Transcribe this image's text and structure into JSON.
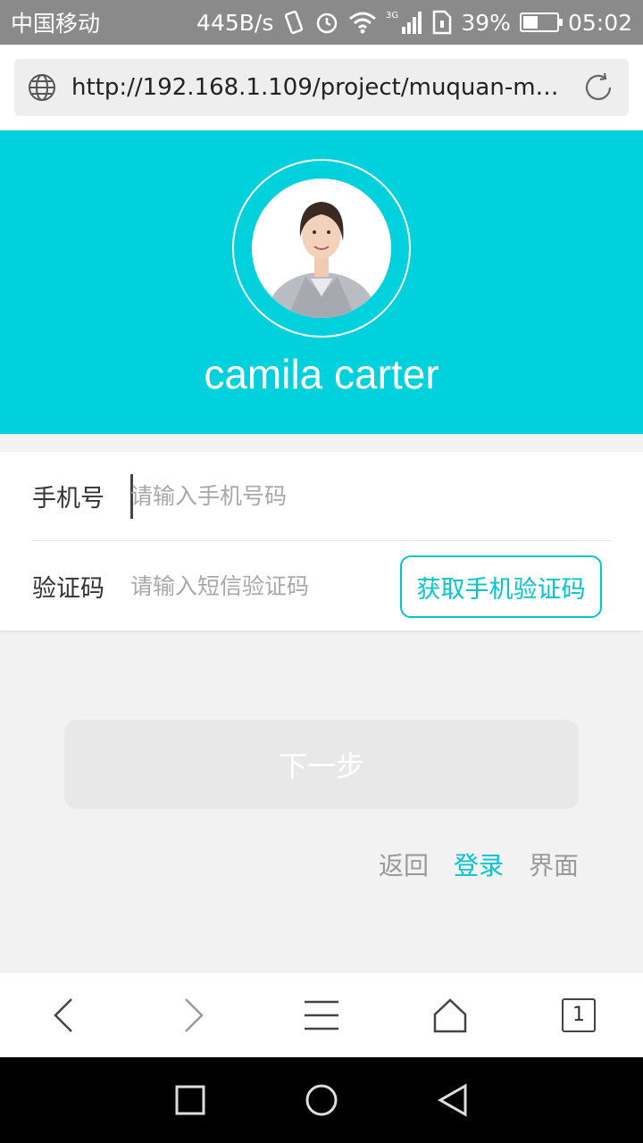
{
  "status_bar": {
    "carrier": "中国移动",
    "speed": "445B/s",
    "network": "3G",
    "battery": "39%",
    "battery_level": 0.39,
    "time": "05:02"
  },
  "browser": {
    "url": "http://192.168.1.109/project/muquan-mo…",
    "tab_count": "1"
  },
  "profile": {
    "name": "camila carter"
  },
  "form": {
    "phone_label": "手机号",
    "phone_placeholder": "请输入手机号码",
    "code_label": "验证码",
    "code_placeholder": "请输入短信验证码",
    "get_code_button": "获取手机验证码"
  },
  "next_button": "下一步",
  "back_link": {
    "part1": "返回",
    "part2": "登录",
    "part3": "界面"
  },
  "colors": {
    "accent": "#00d1dc",
    "status_bar": "#8a8a8a",
    "disabled_button": "#e8e8e8"
  }
}
